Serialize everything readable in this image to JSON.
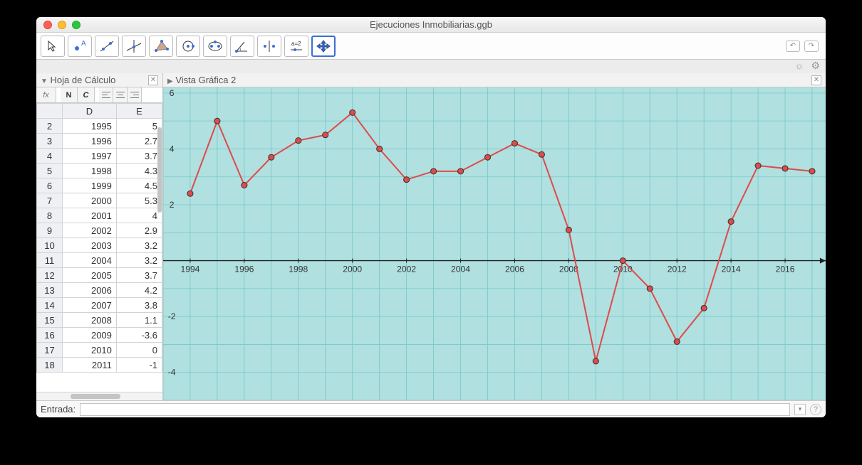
{
  "window": {
    "title": "Ejecuciones Inmobiliarias.ggb"
  },
  "panels": {
    "spreadsheet_title": "Hoja de Cálculo",
    "graphics_title": "Vista Gráfica 2"
  },
  "spreadsheet": {
    "fx_label": "fx",
    "bold_label": "N",
    "italic_label": "C",
    "col_D": "D",
    "col_E": "E",
    "rows": [
      {
        "n": "2",
        "d": "1995",
        "e": "5"
      },
      {
        "n": "3",
        "d": "1996",
        "e": "2.7"
      },
      {
        "n": "4",
        "d": "1997",
        "e": "3.7"
      },
      {
        "n": "5",
        "d": "1998",
        "e": "4.3"
      },
      {
        "n": "6",
        "d": "1999",
        "e": "4.5"
      },
      {
        "n": "7",
        "d": "2000",
        "e": "5.3"
      },
      {
        "n": "8",
        "d": "2001",
        "e": "4"
      },
      {
        "n": "9",
        "d": "2002",
        "e": "2.9"
      },
      {
        "n": "10",
        "d": "2003",
        "e": "3.2"
      },
      {
        "n": "11",
        "d": "2004",
        "e": "3.2"
      },
      {
        "n": "12",
        "d": "2005",
        "e": "3.7"
      },
      {
        "n": "13",
        "d": "2006",
        "e": "4.2"
      },
      {
        "n": "14",
        "d": "2007",
        "e": "3.8"
      },
      {
        "n": "15",
        "d": "2008",
        "e": "1.1"
      },
      {
        "n": "16",
        "d": "2009",
        "e": "-3.6"
      },
      {
        "n": "17",
        "d": "2010",
        "e": "0"
      },
      {
        "n": "18",
        "d": "2011",
        "e": "-1"
      }
    ]
  },
  "input": {
    "label": "Entrada:"
  },
  "chart_data": {
    "type": "line",
    "x": [
      1994,
      1995,
      1996,
      1997,
      1998,
      1999,
      2000,
      2001,
      2002,
      2003,
      2004,
      2005,
      2006,
      2007,
      2008,
      2009,
      2010,
      2011,
      2012,
      2013,
      2014,
      2015,
      2016,
      2017
    ],
    "y": [
      2.4,
      5.0,
      2.7,
      3.7,
      4.3,
      4.5,
      5.3,
      4.0,
      2.9,
      3.2,
      3.2,
      3.7,
      4.2,
      3.8,
      1.1,
      -3.6,
      0.0,
      -1.0,
      -2.9,
      -1.7,
      1.4,
      3.4,
      3.3,
      3.2
    ],
    "xlim": [
      1993,
      2017.5
    ],
    "ylim": [
      -5,
      6.2
    ],
    "x_ticks": [
      1994,
      1996,
      1998,
      2000,
      2002,
      2004,
      2006,
      2008,
      2010,
      2012,
      2014,
      2016
    ],
    "y_ticks": [
      -4,
      -2,
      2,
      4,
      6
    ],
    "grid_color": "#77c8c8",
    "bg_color": "#b0e0e0",
    "line_color": "#e04a4a",
    "point_fill": "#e04a4a",
    "point_stroke": "#333333"
  }
}
